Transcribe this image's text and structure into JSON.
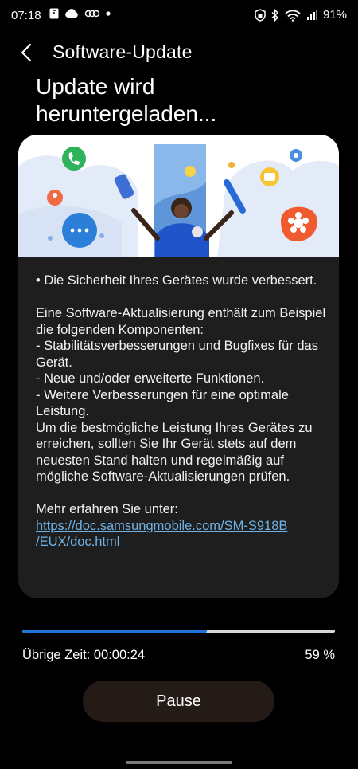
{
  "status_bar": {
    "time": "07:18",
    "battery": "91%",
    "left_icons": [
      "dictionary-icon",
      "cloud-icon",
      "link-icon",
      "dot-icon"
    ],
    "right_icons": [
      "vpn-lock-icon",
      "bluetooth-icon",
      "wifi-icon",
      "signal-icon"
    ]
  },
  "header": {
    "back_icon": "chevron-left-icon",
    "title": "Software-Update"
  },
  "heading": "Update wird heruntergeladen...",
  "card": {
    "illustration": "people-celebrating-illustration",
    "bullet": "• Die Sicherheit Ihres Gerätes wurde verbessert.",
    "intro": "Eine Software-Aktualisierung enthält zum Beispiel die folgenden Komponenten:",
    "items": [
      " - Stabilitätsverbesserungen und Bugfixes für das Gerät.",
      " - Neue und/oder erweiterte Funktionen.",
      " - Weitere Verbesserungen für eine optimale Leistung."
    ],
    "recommendation": "Um die bestmögliche Leistung Ihres Gerätes zu erreichen, sollten Sie Ihr Gerät stets auf dem neuesten Stand halten und regelmäßig auf mögliche Software-Aktualisierungen prüfen.",
    "more_label": "Mehr erfahren Sie unter:",
    "link_line1": "https://doc.samsungmobile.com/SM-S918B",
    "link_line2": "/EUX/doc.html"
  },
  "progress": {
    "fraction": 0.59,
    "remaining_label": "Übrige Zeit: 00:00:24",
    "percent_label": "59 %",
    "accent": "#1e74d9"
  },
  "pause_label": "Pause"
}
